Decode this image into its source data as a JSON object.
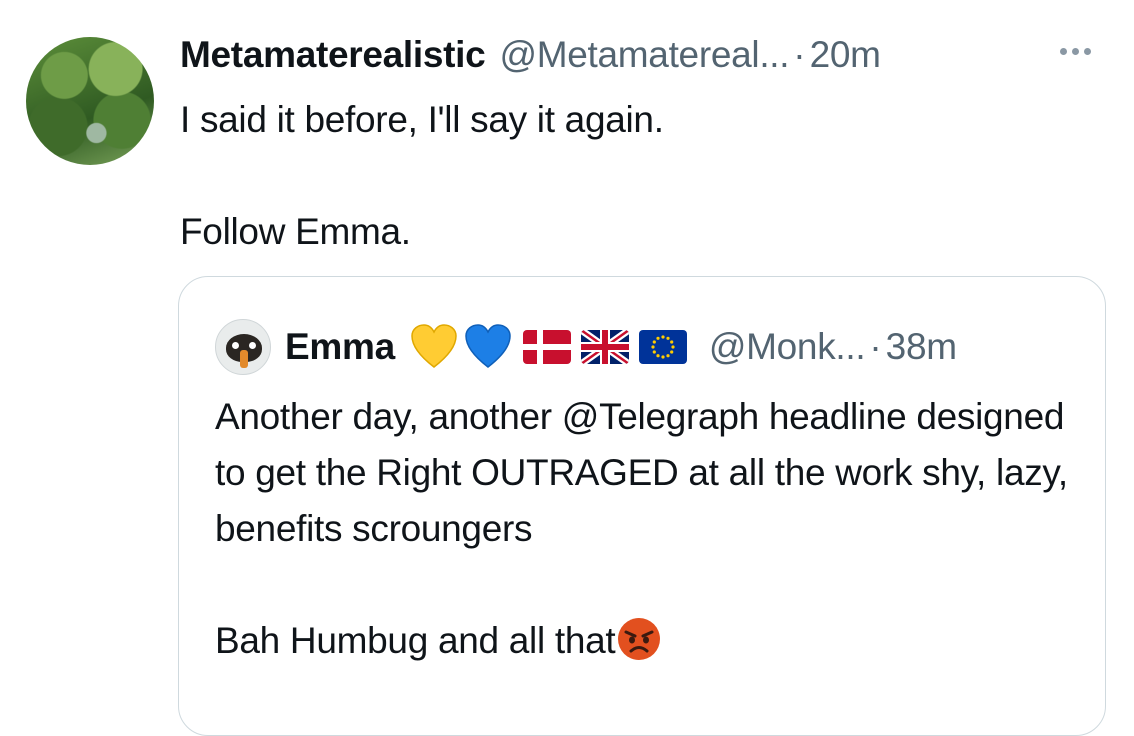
{
  "tweet": {
    "author_name": "Metamaterealistic",
    "author_handle": "@Metamatereal...",
    "separator": "·",
    "time": "20m",
    "text": "I said it before, I'll say it again.\n\nFollow Emma.",
    "more_icon": "more-dots-icon"
  },
  "quote": {
    "author_name": "Emma",
    "icons": [
      "yellow-heart-icon",
      "blue-heart-icon",
      "denmark-flag-icon",
      "uk-flag-icon",
      "eu-flag-icon"
    ],
    "author_handle": "@Monk...",
    "separator": "·",
    "time": "38m",
    "text": "Another day, another @Telegraph headline designed to get the Right OUTRAGED at all the work shy, lazy, benefits scroungers\n\nBah Humbug and all that",
    "trailing_emoji": "angry-face-icon"
  },
  "colors": {
    "text_primary": "#0f1419",
    "text_secondary": "#536471",
    "border": "#cfd9de",
    "heart_yellow": "#ffcc33",
    "heart_blue": "#1d7fe6",
    "angry_face": "#e2501f"
  }
}
